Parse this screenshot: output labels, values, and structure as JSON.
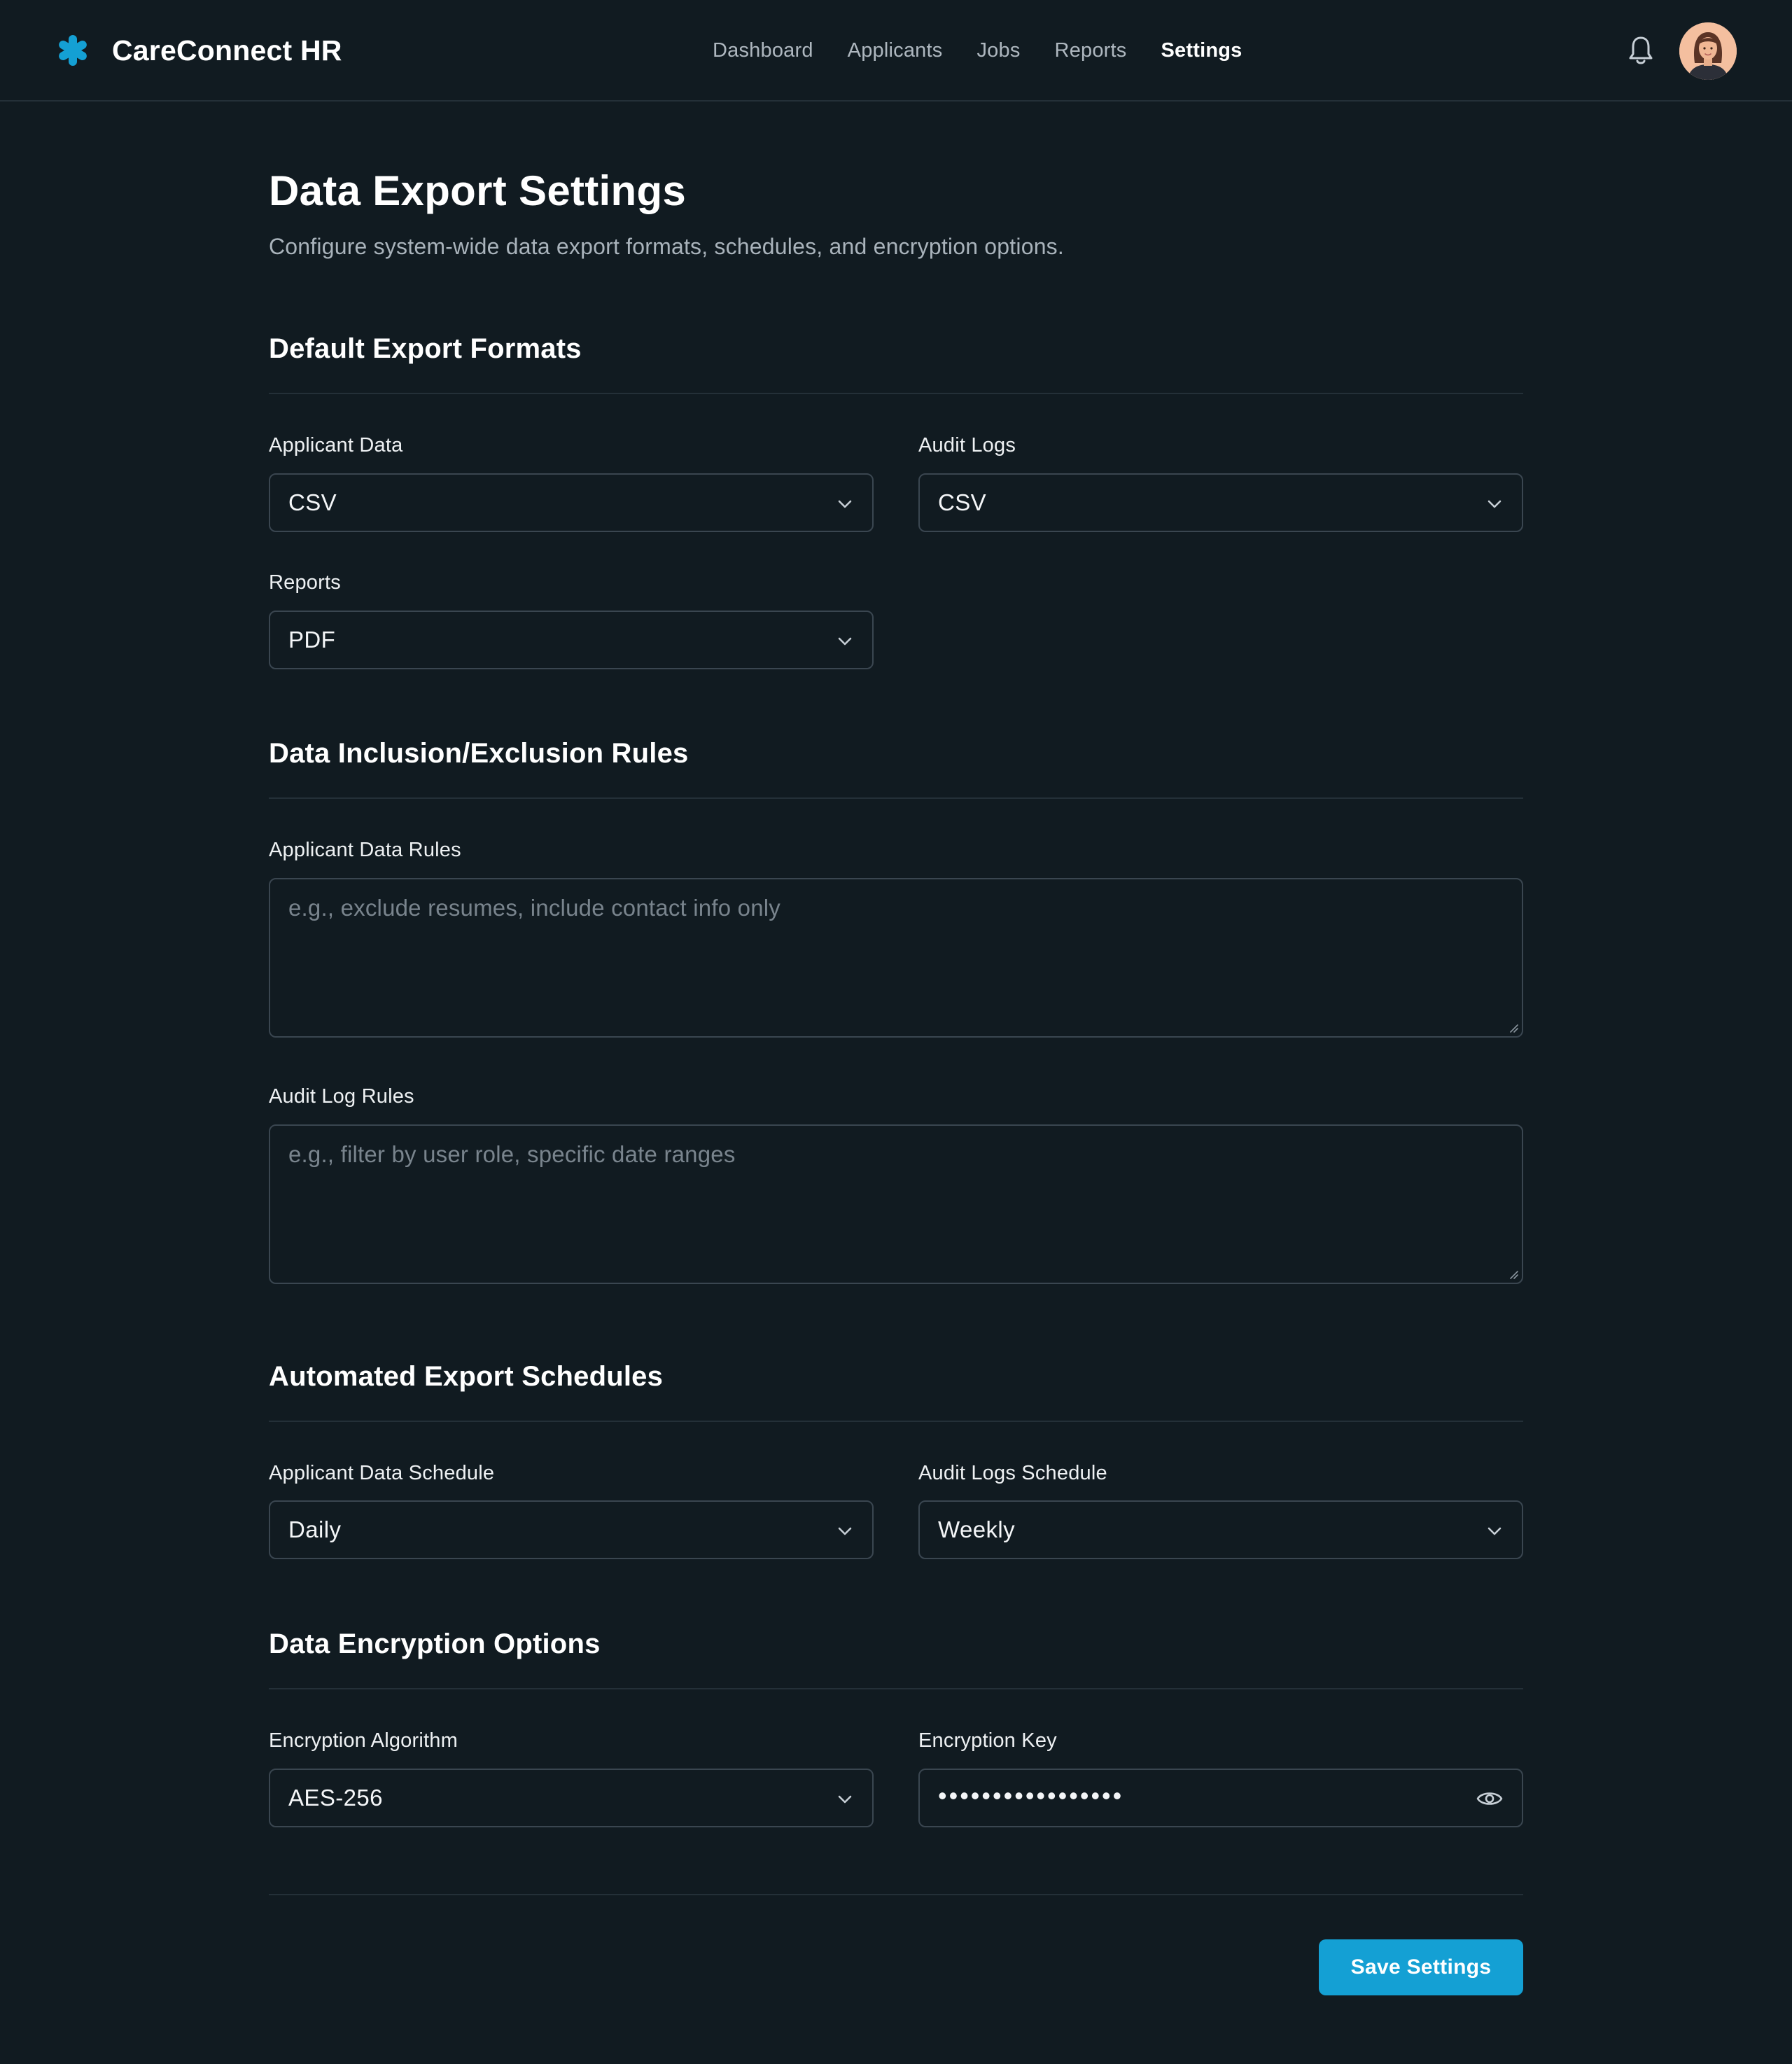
{
  "app": {
    "name": "CareConnect HR",
    "accent_color": "#14a0d4"
  },
  "nav": {
    "items": [
      {
        "label": "Dashboard",
        "active": false
      },
      {
        "label": "Applicants",
        "active": false
      },
      {
        "label": "Jobs",
        "active": false
      },
      {
        "label": "Reports",
        "active": false
      },
      {
        "label": "Settings",
        "active": true
      }
    ]
  },
  "header_icons": {
    "notifications": "bell-icon",
    "avatar": "user-avatar"
  },
  "page": {
    "title": "Data Export Settings",
    "subtitle": "Configure system-wide data export formats, schedules, and encryption options."
  },
  "sections": {
    "formats": {
      "title": "Default Export Formats",
      "applicant_label": "Applicant Data",
      "applicant_value": "CSV",
      "audit_label": "Audit Logs",
      "audit_value": "CSV",
      "reports_label": "Reports",
      "reports_value": "PDF"
    },
    "rules": {
      "title": "Data Inclusion/Exclusion Rules",
      "applicant_label": "Applicant Data Rules",
      "applicant_placeholder": "e.g., exclude resumes, include contact info only",
      "audit_label": "Audit Log Rules",
      "audit_placeholder": "e.g., filter by user role, specific date ranges"
    },
    "schedules": {
      "title": "Automated Export Schedules",
      "applicant_label": "Applicant Data Schedule",
      "applicant_value": "Daily",
      "audit_label": "Audit Logs Schedule",
      "audit_value": "Weekly"
    },
    "encryption": {
      "title": "Data Encryption Options",
      "algorithm_label": "Encryption Algorithm",
      "algorithm_value": "AES-256",
      "key_label": "Encryption Key",
      "key_value": "•••••••••••••••••"
    }
  },
  "actions": {
    "save_label": "Save Settings"
  }
}
